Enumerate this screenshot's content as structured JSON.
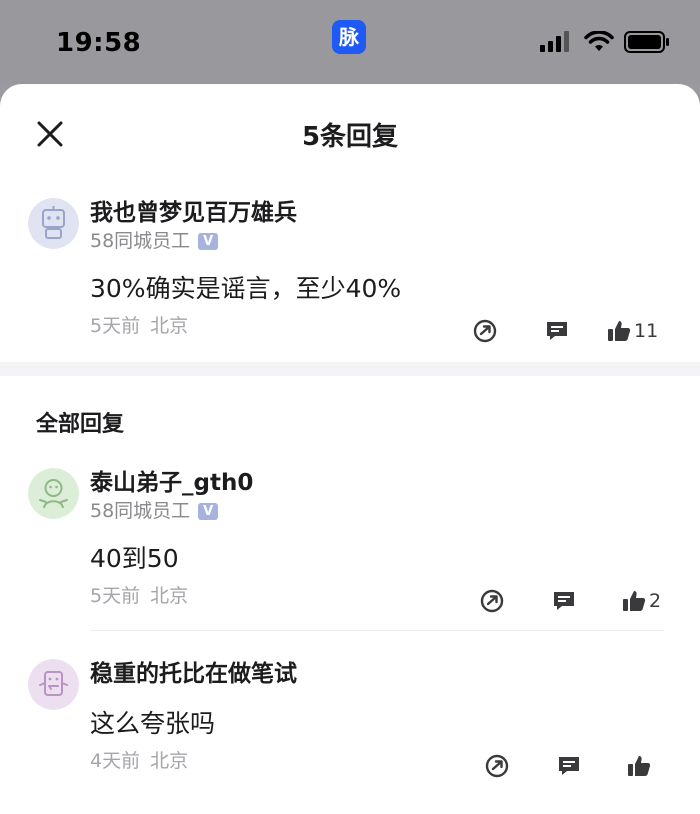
{
  "status_bar": {
    "time": "19:58",
    "app_badge": "脉"
  },
  "sheet": {
    "title": "5条回复",
    "icons": {
      "close": "close-icon"
    }
  },
  "main_comment": {
    "author": "我也曾梦见百万雄兵",
    "company": "58同城员工",
    "verified_mark": "V",
    "text": "30%确实是谣言，至少40%",
    "time": "5天前",
    "location": "北京",
    "like_count": "11"
  },
  "section": {
    "title": "全部回复"
  },
  "replies": [
    {
      "author": "泰山弟子_gth0",
      "company": "58同城员工",
      "verified_mark": "V",
      "text": "40到50",
      "time": "5天前",
      "location": "北京",
      "like_count": "2"
    },
    {
      "author": "稳重的托比在做笔试",
      "text": "这么夸张吗",
      "time": "4天前",
      "location": "北京",
      "like_count": ""
    }
  ],
  "colors": {
    "accent": "#1f5af5",
    "verified": "#a6b3dd",
    "avatar_main": "#dfe3f2",
    "avatar_reply1": "#dcedd8",
    "avatar_reply2": "#ecdff0"
  }
}
